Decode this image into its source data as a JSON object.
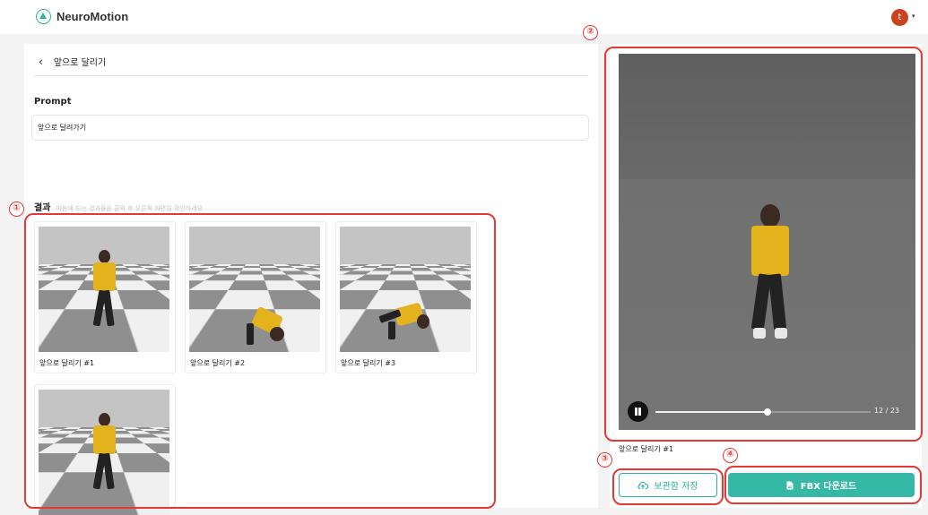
{
  "app": {
    "brand": "NeuroMotion",
    "user_initial": "t",
    "user_menu_caret": "▾"
  },
  "page": {
    "back_icon": "‹",
    "title": "앞으로 달리기",
    "prompt_label": "Prompt",
    "prompt_value": "앞으로 달려가기",
    "results_label": "결과",
    "results_hint": "마음에 드는 결과물을 클릭 후 오른쪽 화면을 확인하세요"
  },
  "results": [
    {
      "label": "앞으로 달리기 #1",
      "pose": "run"
    },
    {
      "label": "앞으로 달리기 #2",
      "pose": "crouch"
    },
    {
      "label": "앞으로 달리기 #3",
      "pose": "fall"
    },
    {
      "label": "",
      "pose": "run"
    }
  ],
  "viewer": {
    "caption": "앞으로 달리기 #1",
    "time": "12 / 23",
    "progress": 0.52,
    "state": "playing"
  },
  "actions": {
    "save_label": "보관함 저장",
    "save_icon": "cloud-upload-icon",
    "fbx_label": "FBX 다운로드",
    "fbx_icon": "file-icon"
  },
  "annotations": [
    "①",
    "②",
    "③",
    "④"
  ],
  "colors": {
    "accent": "#35b8a6",
    "annotation": "#e53935",
    "avatar": "#c8431e"
  }
}
